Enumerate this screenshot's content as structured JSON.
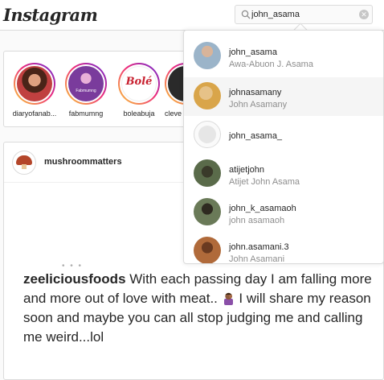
{
  "header": {
    "logo_text": "Instagram",
    "search": {
      "value": "john_asama",
      "placeholder": "Search"
    }
  },
  "stories": [
    {
      "username": "diaryofanab...",
      "color": "#6b3a2a"
    },
    {
      "username": "fabmumng",
      "color": "#7a3b9c",
      "logo_text": "Fabmumng"
    },
    {
      "username": "boleabuja",
      "color": "#c8202f",
      "logo_text": "Bolé"
    },
    {
      "username": "cleve",
      "color": "#2a2a2a"
    }
  ],
  "post": {
    "author": "mushroommatters",
    "caption_user": "zeeliciousfoods",
    "caption_text": "With each passing day I am falling more and more out of love with meat..",
    "caption_text_after": " I will share my reason soon and maybe you can all stop judging me and calling me weird...lol",
    "avatar_color": "#b4462a",
    "avatar_logo_text": "Mushroom Matters"
  },
  "search_results": [
    {
      "username": "john_asama",
      "name": "Awa-Abuon J. Asama",
      "color": "#9bb4c9",
      "highlighted": false
    },
    {
      "username": "johnasamany",
      "name": "John Asamany",
      "color": "#d9a54a",
      "highlighted": true
    },
    {
      "username": "john_asama_",
      "name": "",
      "color": "#dcdcdc",
      "highlighted": false
    },
    {
      "username": "atijetjohn",
      "name": "Atijet John Asama",
      "color": "#5a6b4a",
      "highlighted": false
    },
    {
      "username": "john_k_asamaoh",
      "name": "john asamaoh",
      "color": "#6a7a58",
      "highlighted": false
    },
    {
      "username": "john.asamani.3",
      "name": "John Asamani",
      "color": "#b06a3a",
      "highlighted": false
    }
  ],
  "colors": {
    "border": "#dbdbdb",
    "secondary_text": "#8e8e8e",
    "highlight_row": "#f5f5f5"
  }
}
